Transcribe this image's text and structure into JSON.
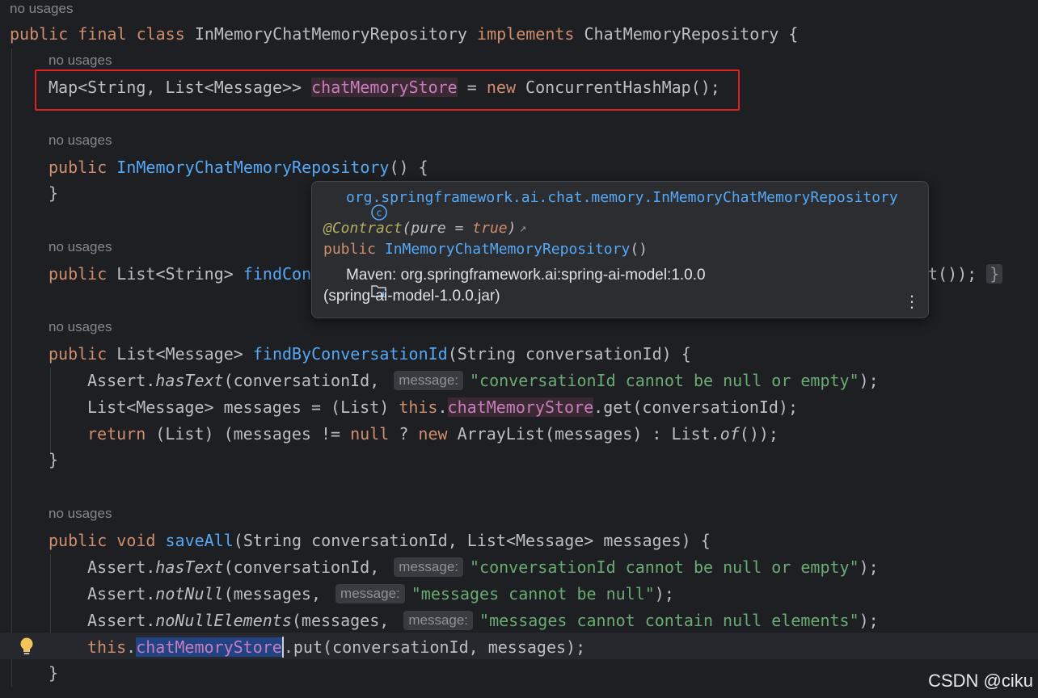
{
  "hints": {
    "no_usages": "no usages"
  },
  "code": {
    "class_decl": {
      "kw1": "public",
      "kw2": "final",
      "kw3": "class",
      "name": "InMemoryChatMemoryRepository",
      "kw4": "implements",
      "iface": "ChatMemoryRepository",
      "tail": " {"
    },
    "field_decl": {
      "type": "Map<String, List<Message>> ",
      "name": "chatMemoryStore",
      "eq": " = ",
      "kw": "new",
      "rest": " ConcurrentHashMap();"
    },
    "ctor": {
      "kw": "public",
      "name": "InMemoryChatMemoryRepository",
      "tail": "() {",
      "close": "}"
    },
    "find_ids": {
      "kw": "public",
      "type": " List<String> ",
      "name": "findCon",
      "tail_visible": "t());",
      "brace": "}"
    },
    "find_by": {
      "kw": "public",
      "type": " List<Message> ",
      "name": "findByConversationId",
      "params": "(String conversationId) {",
      "l1_obj": "Assert.",
      "l1_fn": "hasText",
      "l1_args": "(conversationId, ",
      "l1_hint": "message:",
      "l1_str": "\"conversationId cannot be null or empty\"",
      "l1_end": ");",
      "l2_type": "List<Message> messages = (List) ",
      "l2_this": "this",
      "l2_dot": ".",
      "l2_field": "chatMemoryStore",
      "l2_rest": ".get(conversationId);",
      "l3_ret": "return",
      "l3_a": " (List) (messages != ",
      "l3_null": "null",
      "l3_b": " ? ",
      "l3_new": "new",
      "l3_c": " ArrayList(messages) : List.",
      "l3_of": "of",
      "l3_end": "());",
      "close": "}"
    },
    "save_all": {
      "kw1": "public",
      "kw2": " void ",
      "name": "saveAll",
      "params": "(String conversationId, List<Message> messages) {",
      "l1_obj": "Assert.",
      "l1_fn": "hasText",
      "l1_args": "(conversationId, ",
      "l1_hint": "message:",
      "l1_str": "\"conversationId cannot be null or empty\"",
      "l1_end": ");",
      "l2_obj": "Assert.",
      "l2_fn": "notNull",
      "l2_args": "(messages, ",
      "l2_hint": "message:",
      "l2_str": "\"messages cannot be null\"",
      "l2_end": ");",
      "l3_obj": "Assert.",
      "l3_fn": "noNullElements",
      "l3_args": "(messages, ",
      "l3_hint": "message:",
      "l3_str": "\"messages cannot contain null elements\"",
      "l3_end": ");",
      "l4_this": "this",
      "l4_dot": ".",
      "l4_field": "chatMemoryStore",
      "l4_rest": ".put(conversationId, messages);",
      "close": "}"
    }
  },
  "popup": {
    "fqcn": "org.springframework.ai.chat.memory.InMemoryChatMemoryRepository",
    "annotation": "@Contract",
    "ann_open": "(",
    "ann_key": "pure",
    "ann_eq": " = ",
    "ann_val": "true",
    "ann_close": ")",
    "ann_arrow": "↗",
    "sig_kw": "public",
    "sig_name": "InMemoryChatMemoryRepository",
    "sig_tail": "()",
    "maven": "Maven: org.springframework.ai:spring-ai-model:1.0.0",
    "jar": "(spring-ai-model-1.0.0.jar)",
    "menu": "⋮"
  },
  "watermark": "CSDN @ciku",
  "colors": {
    "background": "#1e1f22",
    "keyword": "#cf8e6d",
    "function": "#56a8f5",
    "field": "#c77dbb",
    "string": "#6aab73",
    "highlight_box": "#e0211f"
  }
}
